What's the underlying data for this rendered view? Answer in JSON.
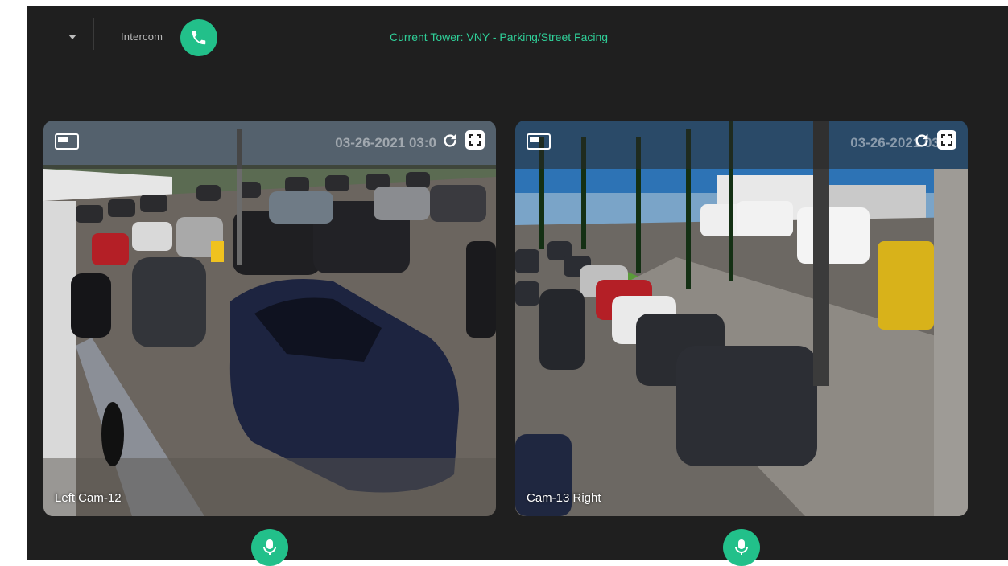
{
  "header": {
    "intercom_label": "Intercom",
    "tower_label": "Current Tower: VNY - Parking/Street Facing"
  },
  "cameras": [
    {
      "label": "Left Cam-12",
      "timestamp": "03-26-2021 03:0"
    },
    {
      "label": "Cam-13 Right",
      "timestamp": "03-26-2021 03:0"
    }
  ],
  "colors": {
    "accent": "#22c08a",
    "tower_text": "#2fcf98",
    "background": "#1f1f1f"
  },
  "icons": [
    "chevron-down-icon",
    "phone-icon",
    "picture-in-picture-icon",
    "refresh-icon",
    "fullscreen-icon",
    "microphone-icon"
  ]
}
